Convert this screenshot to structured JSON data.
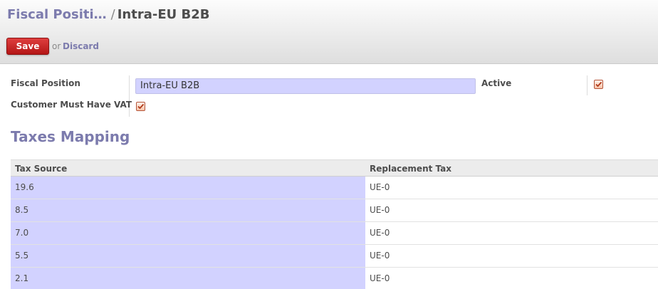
{
  "breadcrumb": {
    "parent": "Fiscal Positi…",
    "separator": "/",
    "current": "Intra-EU B2B"
  },
  "toolbar": {
    "save_label": "Save",
    "or_text": "or",
    "discard_label": "Discard"
  },
  "form": {
    "fiscal_position_label": "Fiscal Position",
    "fiscal_position_value": "Intra-EU B2B",
    "active_label": "Active",
    "active_checked": true,
    "customer_vat_label": "Customer Must Have VAT",
    "customer_vat_checked": true
  },
  "taxes_mapping": {
    "title": "Taxes Mapping",
    "columns": [
      "Tax Source",
      "Replacement Tax"
    ],
    "rows": [
      [
        "19.6",
        "UE-0"
      ],
      [
        "8.5",
        "UE-0"
      ],
      [
        "7.0",
        "UE-0"
      ],
      [
        "5.5",
        "UE-0"
      ],
      [
        "2.1",
        "UE-0"
      ]
    ]
  },
  "colors": {
    "accent": "#7c7bad",
    "save_button": "#c42222",
    "editable_field": "#d2d2ff",
    "checkbox": "#e87d52"
  }
}
